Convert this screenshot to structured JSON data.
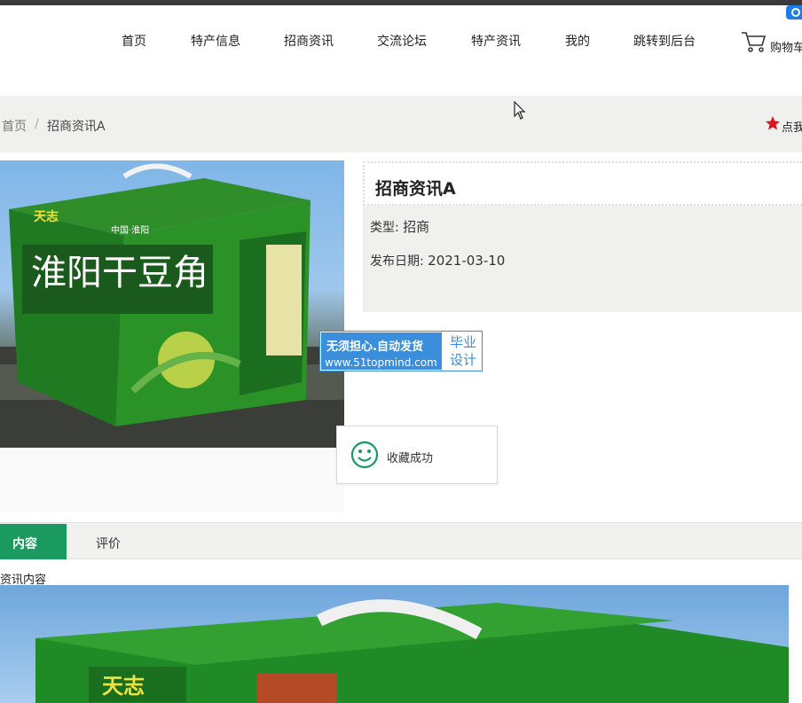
{
  "nav": {
    "items": [
      {
        "label": "首页"
      },
      {
        "label": "特产信息"
      },
      {
        "label": "招商资讯"
      },
      {
        "label": "交流论坛"
      },
      {
        "label": "特产资讯"
      },
      {
        "label": "我的"
      },
      {
        "label": "跳转到后台"
      }
    ],
    "cart_label": "购物车"
  },
  "breadcrumb": {
    "home": "首页",
    "separator": "/",
    "current": "招商资讯A"
  },
  "favorite_link": "点我收藏",
  "product": {
    "title": "招商资讯A",
    "type_label": "类型:",
    "type_value": "招商",
    "date_label": "发布日期:",
    "date_value": "2021-03-10",
    "image_text": {
      "brand": "天志",
      "name": "淮阳干豆角",
      "top": "中国·淮阳"
    }
  },
  "watermark": {
    "line1": "无须担心.自动发货",
    "line2": "www.51topmind.com",
    "right_line1": "毕业",
    "right_line2": "设计"
  },
  "toast": {
    "message": "收藏成功"
  },
  "tabs": [
    {
      "label": "内容",
      "active": true
    },
    {
      "label": "评价",
      "active": false
    }
  ],
  "content_label": "资讯内容",
  "colors": {
    "accent": "#1a9a5e",
    "watermark_blue": "#3a8edc",
    "star_red": "#e0141e"
  }
}
